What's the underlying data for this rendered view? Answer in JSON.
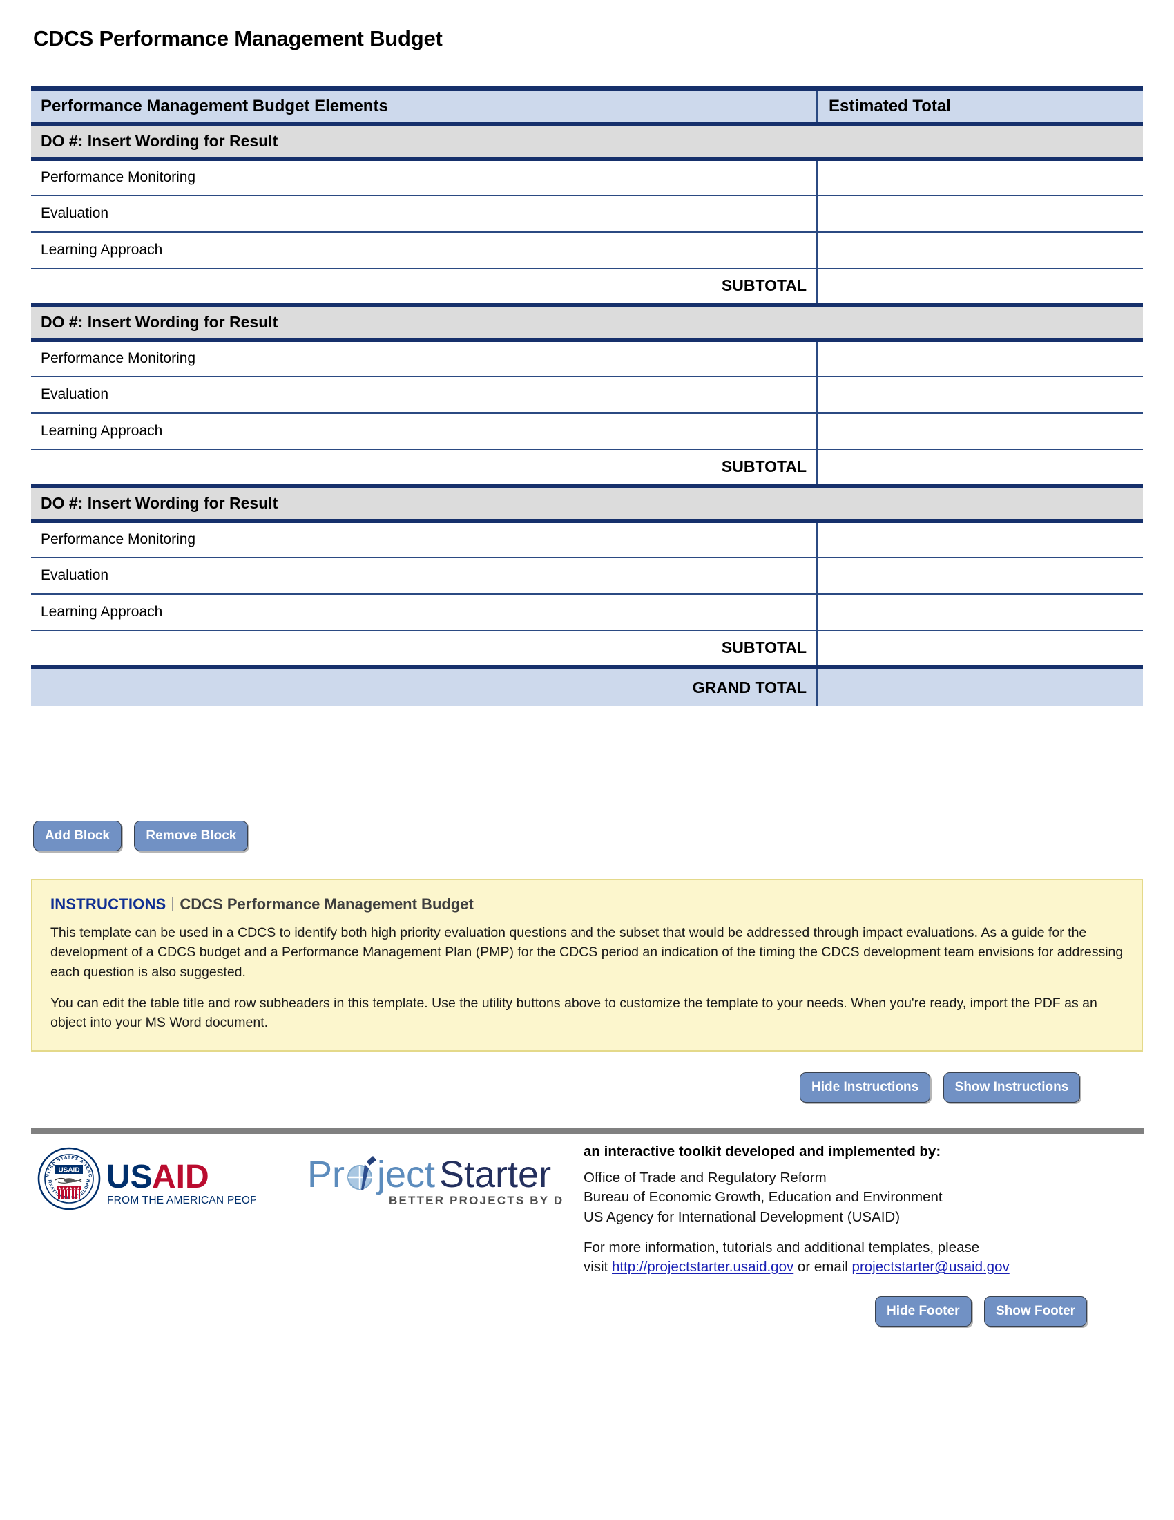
{
  "document": {
    "title": "CDCS Performance Management Budget"
  },
  "table": {
    "headers": {
      "elements": "Performance Management Budget Elements",
      "estimated_total": "Estimated Total"
    },
    "blocks": [
      {
        "do_header": "DO #: Insert Wording for Result",
        "rows": [
          {
            "label": "Performance Monitoring",
            "value": ""
          },
          {
            "label": "Evaluation",
            "value": ""
          },
          {
            "label": "Learning Approach",
            "value": ""
          }
        ],
        "subtotal_label": "SUBTOTAL",
        "subtotal_value": ""
      },
      {
        "do_header": "DO #: Insert Wording for Result",
        "rows": [
          {
            "label": "Performance Monitoring",
            "value": ""
          },
          {
            "label": "Evaluation",
            "value": ""
          },
          {
            "label": "Learning Approach",
            "value": ""
          }
        ],
        "subtotal_label": "SUBTOTAL",
        "subtotal_value": ""
      },
      {
        "do_header": "DO #: Insert Wording for Result",
        "rows": [
          {
            "label": "Performance Monitoring",
            "value": ""
          },
          {
            "label": "Evaluation",
            "value": ""
          },
          {
            "label": "Learning Approach",
            "value": ""
          }
        ],
        "subtotal_label": "SUBTOTAL",
        "subtotal_value": ""
      }
    ],
    "grand_total_label": "GRAND TOTAL",
    "grand_total_value": ""
  },
  "utility_buttons": {
    "add_block": "Add Block",
    "remove_block": "Remove Block"
  },
  "instructions": {
    "label": "INSTRUCTIONS",
    "subject": "CDCS Performance Management Budget",
    "paragraph1": "This template can be used in a CDCS to identify both high priority evaluation questions and the subset that would be addressed through impact evaluations. As a guide for the development of a CDCS budget and a Performance Management Plan (PMP) for the CDCS period an indication of the timing the CDCS development team envisions for addressing each question is also suggested.",
    "paragraph2": "You can edit the table title and row subheaders in this template. Use the utility buttons above to customize the template to your needs. When you're ready, import the PDF as an object into your MS Word document.",
    "hide_button": "Hide Instructions",
    "show_button": "Show Instructions"
  },
  "footer": {
    "usaid_logo": {
      "seal_top_text": "UNITED STATES AGENCY",
      "seal_bottom_text": "INTERNATIONAL DEVELOPMENT",
      "seal_badge": "USAID",
      "wordmark_us": "US",
      "wordmark_aid": "AID",
      "tagline": "FROM THE AMERICAN PEOPLE"
    },
    "projectstarter_logo": {
      "name_part1": "Pr",
      "name_part2": "ject",
      "name_part3": "Starter",
      "tagline": "BETTER PROJECTS BY DESIGN"
    },
    "headline": "an interactive toolkit developed and implemented by:",
    "org_line1": "Office of Trade and Regulatory Reform",
    "org_line2": "Bureau of Economic Growth, Education and Environment",
    "org_line3": "US Agency for International Development (USAID)",
    "contact_prefix": "For more information, tutorials and additional templates, please",
    "contact_visit": "visit ",
    "contact_url": "http://projectstarter.usaid.gov",
    "contact_mid": " or email ",
    "contact_email": "projectstarter@usaid.gov",
    "hide_button": "Hide Footer",
    "show_button": "Show Footer"
  },
  "colors": {
    "navy": "#16306b",
    "header_blue": "#cdd9ec",
    "do_gray": "#dcdcdc",
    "button_blue": "#7191c4",
    "instruction_yellow": "#fcf6cd",
    "link_blue": "#1a20b5",
    "usaid_blue": "#002f6c",
    "usaid_red": "#ba0c2f",
    "rule_gray": "#808080"
  }
}
